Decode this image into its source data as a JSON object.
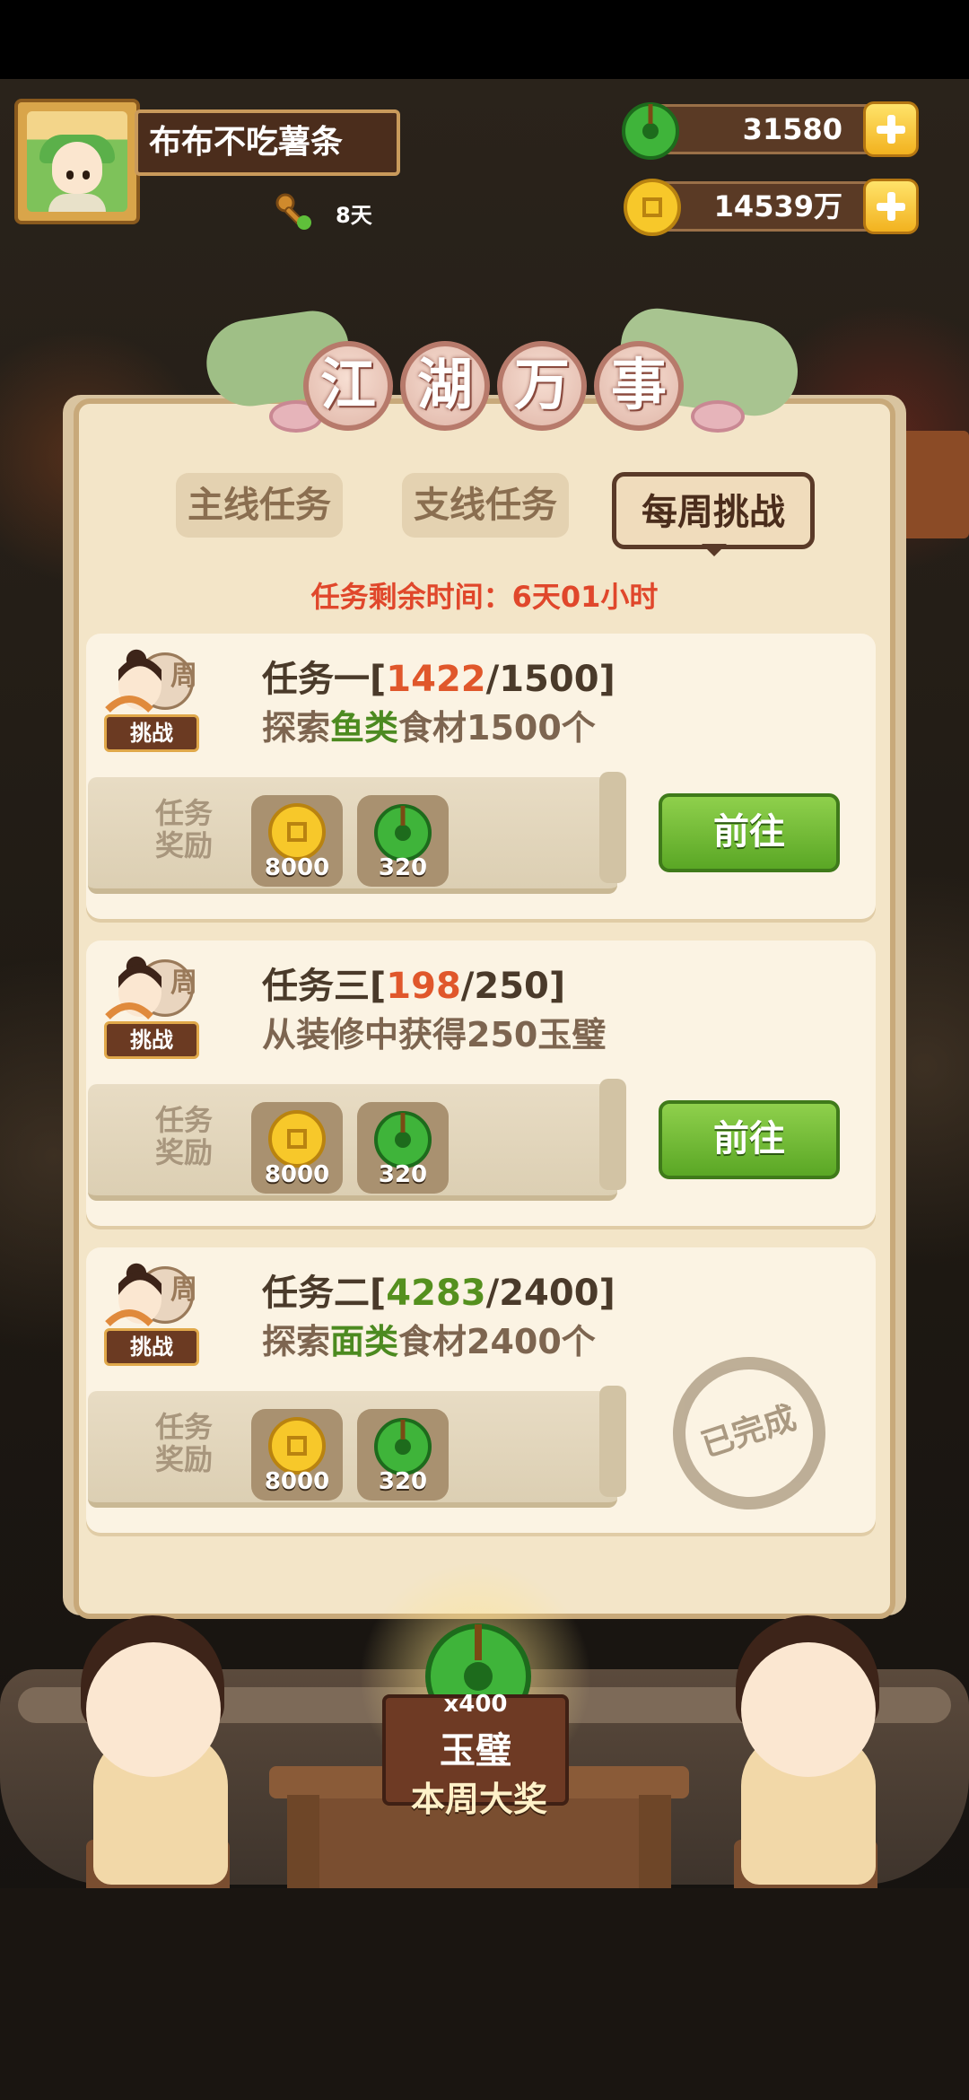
{
  "player": {
    "name": "布布不吃薯条",
    "days": "8天"
  },
  "currency": {
    "jade": "31580",
    "coins": "14539万"
  },
  "panel": {
    "title_chars": [
      "江",
      "湖",
      "万",
      "事"
    ],
    "tabs": [
      {
        "label": "主线任务",
        "active": false
      },
      {
        "label": "支线任务",
        "active": false
      },
      {
        "label": "每周挑战",
        "active": true
      }
    ],
    "timer": "任务剩余时间：6天01小时"
  },
  "tasks": [
    {
      "name": "任务一",
      "progress": "1422",
      "target": "1500",
      "progress_color": "#e0572b",
      "desc_pre": "探索",
      "desc_hl": "鱼类",
      "desc_post": "食材1500个",
      "badge": "挑战",
      "seal": "周",
      "reward_label": "任务奖励",
      "rewards": [
        {
          "icon": "coin-icon",
          "amount": "8000"
        },
        {
          "icon": "jade-icon",
          "amount": "320"
        }
      ],
      "status": "go",
      "button_label": "前往"
    },
    {
      "name": "任务三",
      "progress": "198",
      "target": "250",
      "progress_color": "#e0572b",
      "desc_pre": "从装修中获得250玉璧",
      "desc_hl": "",
      "desc_post": "",
      "badge": "挑战",
      "seal": "周",
      "reward_label": "任务奖励",
      "rewards": [
        {
          "icon": "coin-icon",
          "amount": "8000"
        },
        {
          "icon": "jade-icon",
          "amount": "320"
        }
      ],
      "status": "go",
      "button_label": "前往"
    },
    {
      "name": "任务二",
      "progress": "4283",
      "target": "2400",
      "progress_color": "#55901e",
      "desc_pre": "探索",
      "desc_hl": "面类",
      "desc_post": "食材2400个",
      "badge": "挑战",
      "seal": "周",
      "reward_label": "任务奖励",
      "rewards": [
        {
          "icon": "coin-icon",
          "amount": "8000"
        },
        {
          "icon": "jade-icon",
          "amount": "320"
        }
      ],
      "status": "done",
      "stamp_label": "已完成"
    }
  ],
  "grand_prize": {
    "count": "x400",
    "name": "玉璧",
    "caption": "本周大奖"
  }
}
